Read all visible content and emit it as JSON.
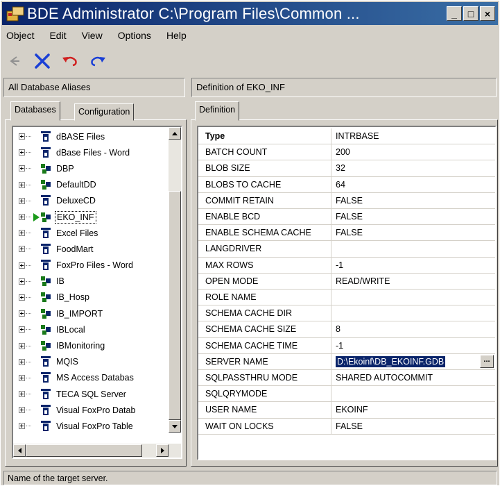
{
  "window": {
    "title": "BDE Administrator  C:\\Program Files\\Common ...",
    "controls": {
      "minimize": "_",
      "maximize": "□",
      "close": "×"
    }
  },
  "menu": [
    "Object",
    "Edit",
    "View",
    "Options",
    "Help"
  ],
  "toolbar": {
    "icons": [
      "back-icon",
      "delete-icon",
      "undo-icon",
      "redo-icon"
    ],
    "colors": {
      "delete": "#1a3fd6",
      "undo": "#d02020",
      "redo": "#1a3fd6"
    }
  },
  "left_header": "All Database Aliases",
  "right_header": "Definition of EKO_INF",
  "left_tabs": {
    "databases": "Databases",
    "configuration": "Configuration"
  },
  "right_tab": "Definition",
  "tree": [
    {
      "label": "dBASE Files",
      "icon": "database-icon"
    },
    {
      "label": "dBase Files - Word",
      "icon": "database-icon"
    },
    {
      "label": "DBP",
      "icon": "network-database-icon"
    },
    {
      "label": "DefaultDD",
      "icon": "network-database-icon"
    },
    {
      "label": "DeluxeCD",
      "icon": "database-icon"
    },
    {
      "label": "EKO_INF",
      "icon": "network-database-icon",
      "selected": true
    },
    {
      "label": "Excel Files",
      "icon": "database-icon"
    },
    {
      "label": "FoodMart",
      "icon": "database-icon"
    },
    {
      "label": "FoxPro Files - Word",
      "icon": "database-icon"
    },
    {
      "label": "IB",
      "icon": "network-database-icon"
    },
    {
      "label": "IB_Hosp",
      "icon": "network-database-icon"
    },
    {
      "label": "IB_IMPORT",
      "icon": "network-database-icon"
    },
    {
      "label": "IBLocal",
      "icon": "network-database-icon"
    },
    {
      "label": "IBMonitoring",
      "icon": "network-database-icon"
    },
    {
      "label": "MQIS",
      "icon": "database-icon"
    },
    {
      "label": "MS Access Databas",
      "icon": "database-icon"
    },
    {
      "label": "TECA SQL Server",
      "icon": "database-icon"
    },
    {
      "label": "Visual FoxPro Datab",
      "icon": "database-icon"
    },
    {
      "label": "Visual FoxPro Table",
      "icon": "database-icon"
    }
  ],
  "properties": [
    {
      "name": "Type",
      "value": "INTRBASE",
      "header": true
    },
    {
      "name": "BATCH COUNT",
      "value": "200"
    },
    {
      "name": "BLOB SIZE",
      "value": "32"
    },
    {
      "name": "BLOBS TO CACHE",
      "value": "64"
    },
    {
      "name": "COMMIT RETAIN",
      "value": "FALSE"
    },
    {
      "name": "ENABLE BCD",
      "value": "FALSE"
    },
    {
      "name": "ENABLE SCHEMA CACHE",
      "value": "FALSE"
    },
    {
      "name": "LANGDRIVER",
      "value": ""
    },
    {
      "name": "MAX ROWS",
      "value": "-1"
    },
    {
      "name": "OPEN MODE",
      "value": "READ/WRITE"
    },
    {
      "name": "ROLE NAME",
      "value": ""
    },
    {
      "name": "SCHEMA CACHE DIR",
      "value": ""
    },
    {
      "name": "SCHEMA CACHE SIZE",
      "value": "8"
    },
    {
      "name": "SCHEMA CACHE TIME",
      "value": "-1"
    },
    {
      "name": "SERVER NAME",
      "value": "D:\\Ekoinf\\DB_EKOINF.GDB",
      "selected": true,
      "button": "..."
    },
    {
      "name": "SQLPASSTHRU MODE",
      "value": "SHARED AUTOCOMMIT"
    },
    {
      "name": "SQLQRYMODE",
      "value": ""
    },
    {
      "name": "USER NAME",
      "value": "EKOINF"
    },
    {
      "name": "WAIT ON LOCKS",
      "value": "FALSE"
    }
  ],
  "status": "Name of the target server."
}
